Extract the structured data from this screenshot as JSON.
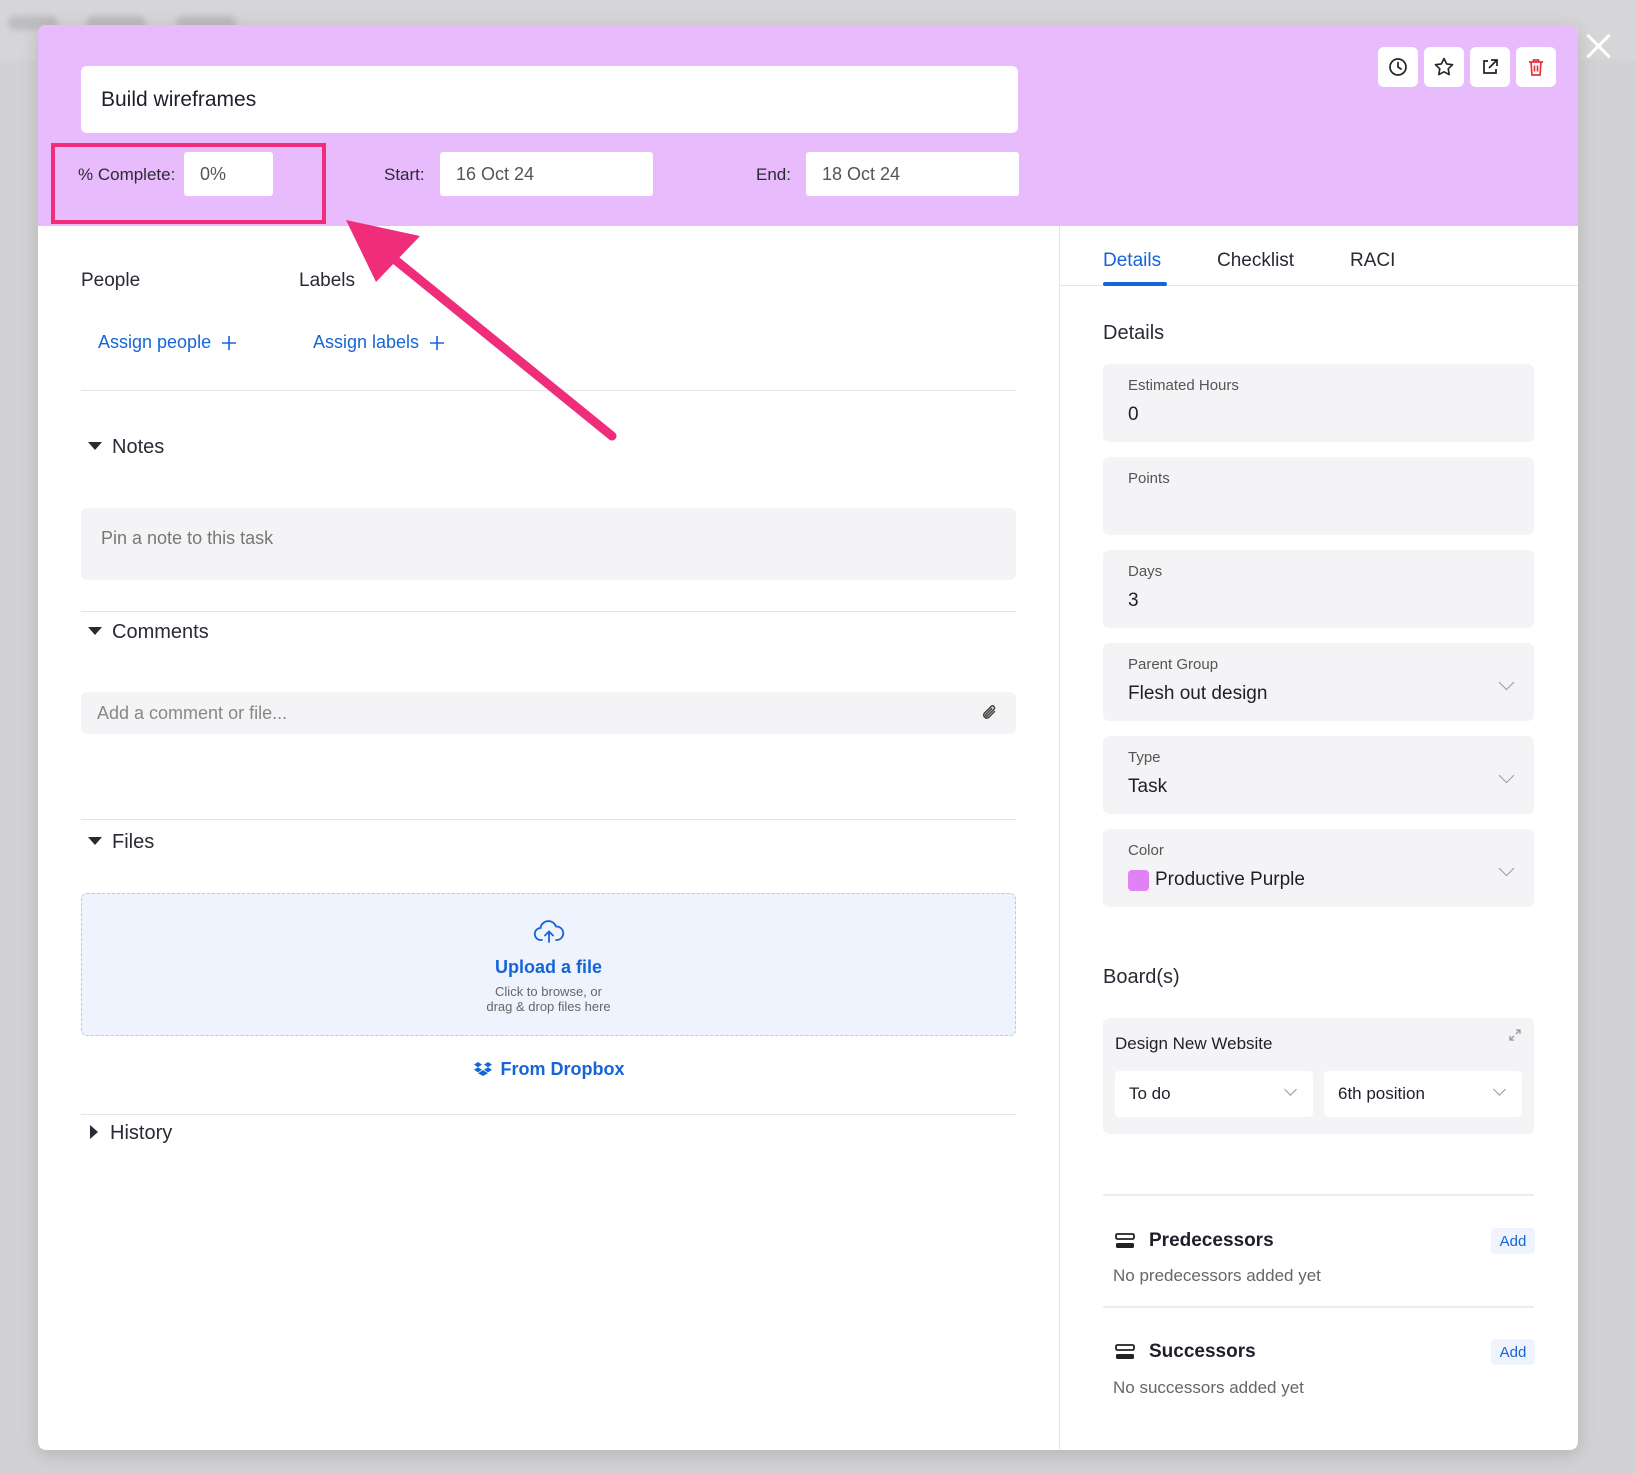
{
  "task": {
    "title": "Build wireframes",
    "complete_label": "% Complete:",
    "complete_value": "0%",
    "start_label": "Start:",
    "start_value": "16 Oct 24",
    "end_label": "End:",
    "end_value": "18 Oct 24"
  },
  "header_buttons": [
    "clock-icon",
    "star-icon",
    "external-link-icon",
    "trash-icon"
  ],
  "left": {
    "people_label": "People",
    "labels_label": "Labels",
    "assign_people": "Assign people",
    "assign_labels": "Assign labels",
    "notes_title": "Notes",
    "notes_placeholder": "Pin a note to this task",
    "comments_title": "Comments",
    "comments_placeholder": "Add a comment or file...",
    "files_title": "Files",
    "upload_title": "Upload a file",
    "upload_sub1": "Click to browse, or",
    "upload_sub2": "drag & drop files here",
    "dropbox": "From Dropbox",
    "history_title": "History"
  },
  "right": {
    "tabs": [
      "Details",
      "Checklist",
      "RACI"
    ],
    "active_tab": "Details",
    "details_title": "Details",
    "fields": {
      "estimated_hours": {
        "label": "Estimated Hours",
        "value": "0"
      },
      "points": {
        "label": "Points",
        "value": ""
      },
      "days": {
        "label": "Days",
        "value": "3"
      },
      "parent_group": {
        "label": "Parent Group",
        "value": "Flesh out design"
      },
      "type": {
        "label": "Type",
        "value": "Task"
      },
      "color": {
        "label": "Color",
        "value": "Productive Purple",
        "swatch": "#e082f3"
      }
    },
    "boards_title": "Board(s)",
    "board": {
      "name": "Design New Website",
      "column": "To do",
      "position": "6th position"
    },
    "predecessors": {
      "title": "Predecessors",
      "add": "Add",
      "empty": "No predecessors added yet"
    },
    "successors": {
      "title": "Successors",
      "add": "Add",
      "empty": "No successors added yet"
    }
  },
  "colors": {
    "header": "#e8bcfc",
    "accent": "#1565d8",
    "highlight": "#ef2d7b"
  }
}
